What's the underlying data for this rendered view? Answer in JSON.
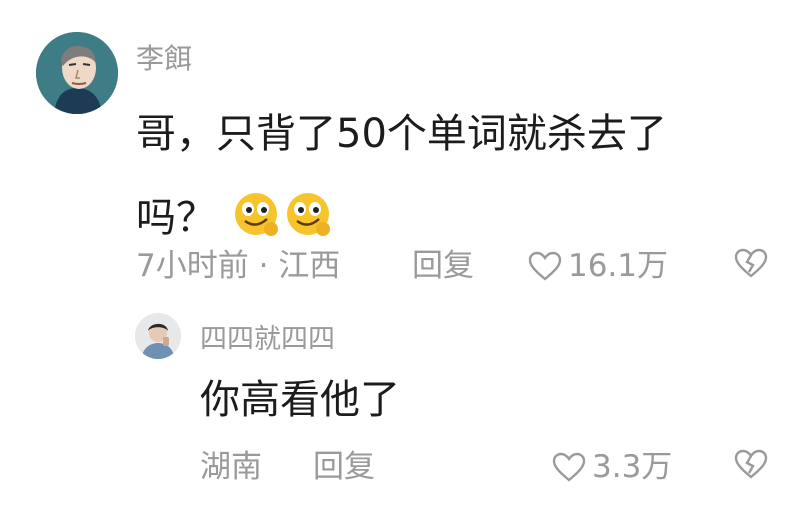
{
  "comment": {
    "username": "李餌",
    "text_line1": "哥，只背了50个单词就杀去了",
    "text_line2": "吗？",
    "emoji": [
      "smirk-emoji",
      "smirk-emoji"
    ],
    "time": "7小时前",
    "dot": "·",
    "location": "江西",
    "reply_label": "回复",
    "likes": "16.1万"
  },
  "reply": {
    "username": "四四就四四",
    "text": "你高看他了",
    "location": "湖南",
    "reply_label": "回复",
    "likes": "3.3万"
  },
  "icons": {
    "like": "heart-outline-icon",
    "dislike": "broken-heart-icon"
  },
  "colors": {
    "text": "#1c1c1c",
    "meta": "#9a9a9a",
    "emoji_yellow": "#f7c52b"
  }
}
